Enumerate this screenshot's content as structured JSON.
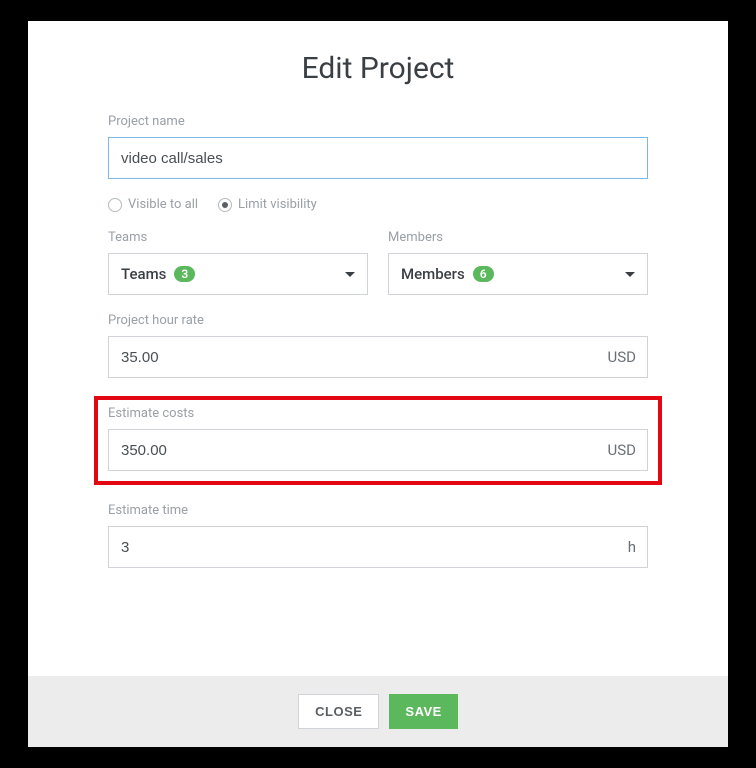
{
  "title": "Edit Project",
  "fields": {
    "projectName": {
      "label": "Project name",
      "value": "video call/sales"
    },
    "visibility": {
      "visibleToAll": "Visible to all",
      "limitVisibility": "Limit visibility",
      "selected": "limit"
    },
    "teams": {
      "label": "Teams",
      "selectLabel": "Teams",
      "count": "3"
    },
    "members": {
      "label": "Members",
      "selectLabel": "Members",
      "count": "6"
    },
    "hourRate": {
      "label": "Project hour rate",
      "value": "35.00",
      "suffix": "USD"
    },
    "estimateCosts": {
      "label": "Estimate costs",
      "value": "350.00",
      "suffix": "USD"
    },
    "estimateTime": {
      "label": "Estimate time",
      "value": "3",
      "suffix": "h"
    }
  },
  "buttons": {
    "close": "CLOSE",
    "save": "SAVE"
  }
}
